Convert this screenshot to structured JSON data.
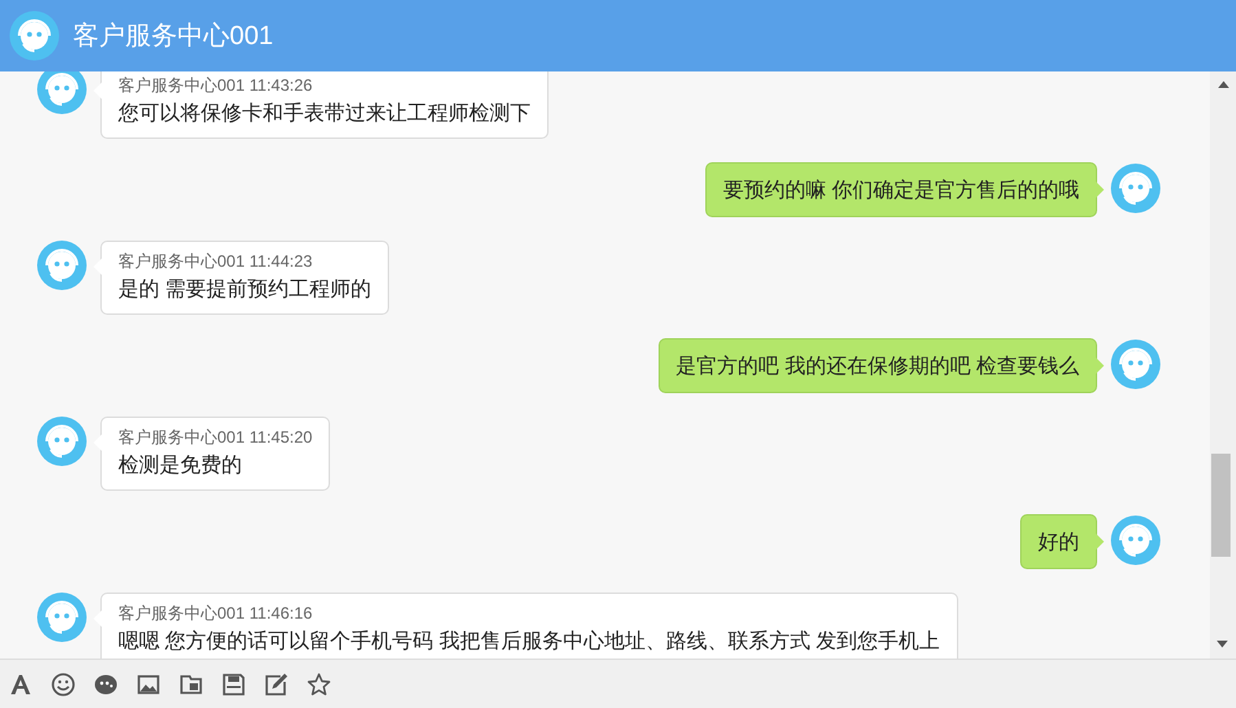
{
  "header": {
    "title": "客户服务中心001"
  },
  "messages": [
    {
      "kind": "agent",
      "meta": "客户服务中心001 11:43:26",
      "text": "您可以将保修卡和手表带过来让工程师检测下"
    },
    {
      "kind": "user",
      "text": "要预约的嘛  你们确定是官方售后的的哦"
    },
    {
      "kind": "agent",
      "meta": "客户服务中心001 11:44:23",
      "text": "是的 需要提前预约工程师的"
    },
    {
      "kind": "user",
      "text": "是官方的吧  我的还在保修期的吧  检查要钱么"
    },
    {
      "kind": "agent",
      "meta": "客户服务中心001 11:45:20",
      "text": "检测是免费的"
    },
    {
      "kind": "user",
      "text": "好的"
    },
    {
      "kind": "agent",
      "meta": "客户服务中心001 11:46:16",
      "text": "嗯嗯 您方便的话可以留个手机号码 我把售后服务中心地址、路线、联系方式 发到您手机上"
    }
  ],
  "toolbar": [
    {
      "kind": "font"
    },
    {
      "kind": "emoji"
    },
    {
      "kind": "chat"
    },
    {
      "kind": "image"
    },
    {
      "kind": "folder"
    },
    {
      "kind": "save"
    },
    {
      "kind": "edit"
    },
    {
      "kind": "star"
    }
  ]
}
